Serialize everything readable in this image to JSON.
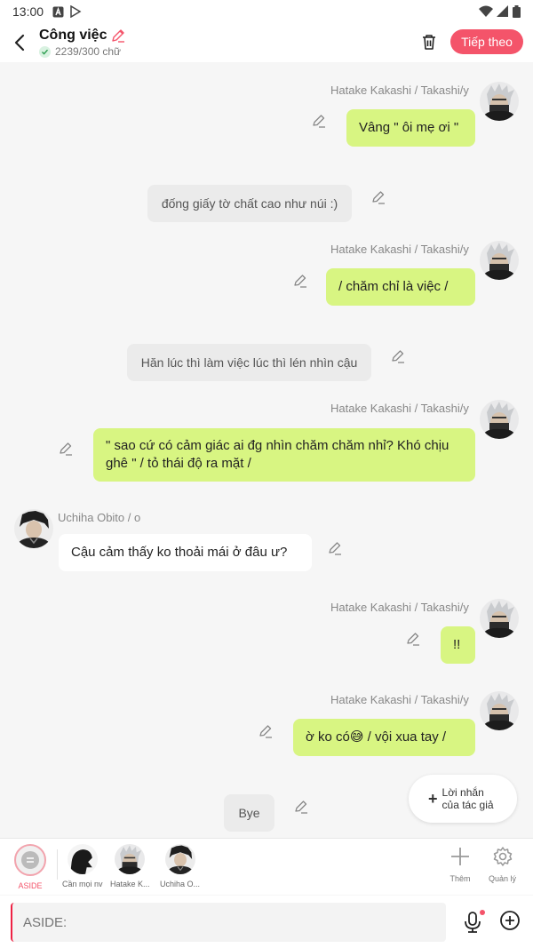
{
  "status_bar": {
    "time": "13:00"
  },
  "header": {
    "title": "Công việc",
    "word_count": "2239/300 chữ",
    "next_label": "Tiếp theo"
  },
  "messages": [
    {
      "type": "right",
      "name": "Hatake Kakashi / Takashi/y",
      "text": "Vâng \" ôi mẹ ơi \""
    },
    {
      "type": "center",
      "text": "đống giấy tờ chất cao như núi :)"
    },
    {
      "type": "right",
      "name": "Hatake Kakashi / Takashi/y",
      "text": "/ chăm chỉ là việc /"
    },
    {
      "type": "center",
      "text": "Hăn lúc thì làm việc lúc thì lén nhìn cậu"
    },
    {
      "type": "right",
      "name": "Hatake Kakashi / Takashi/y",
      "text": "\" sao cứ có cảm giác ai đg nhìn chăm chăm nhỉ? Khó chịu ghê \" / tỏ thái độ ra mặt /"
    },
    {
      "type": "left",
      "name": "Uchiha Obito / o",
      "text": "Cậu cảm thấy ko thoải mái ở đâu ư?"
    },
    {
      "type": "right",
      "name": "Hatake Kakashi / Takashi/y",
      "text": "!!"
    },
    {
      "type": "right",
      "name": "Hatake Kakashi / Takashi/y",
      "text": "ờ ko có😅 / vội xua tay /"
    },
    {
      "type": "center",
      "text": "Bye"
    }
  ],
  "author_note": {
    "line1": "Lời nhắn",
    "line2": "của tác giả"
  },
  "characters": [
    {
      "label": "ASIDE"
    },
    {
      "label": "Cần mọi nv"
    },
    {
      "label": "Hatake K..."
    },
    {
      "label": "Uchiha O..."
    }
  ],
  "tools": {
    "add_label": "Thêm",
    "manage_label": "Quản lý"
  },
  "input": {
    "placeholder": "ASIDE:"
  },
  "colors": {
    "accent": "#f4546a",
    "bubble_green": "#d8f582",
    "bubble_grey": "#ebebeb"
  }
}
